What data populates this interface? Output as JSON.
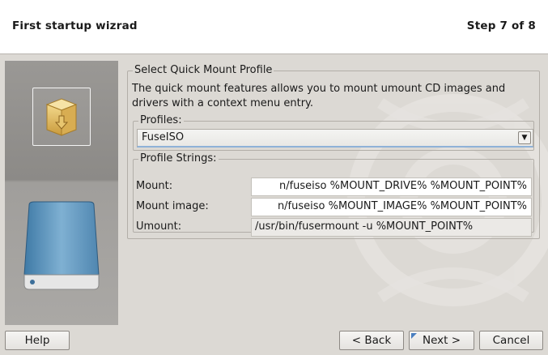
{
  "header": {
    "title": "First startup wizrad",
    "step": "Step 7 of 8"
  },
  "side": {
    "top_icon": "package-icon",
    "bottom_icon": "hard-drive-icon"
  },
  "main": {
    "group_title": "Select Quick Mount Profile",
    "description": "The quick mount features allows you to mount umount CD images and drivers with a context menu entry.",
    "profiles": {
      "title": "Profiles:",
      "selected": "FuseISO"
    },
    "strings": {
      "title": "Profile Strings:",
      "mount_label": "Mount:",
      "mount_value": "n/fuseiso %MOUNT_DRIVE% %MOUNT_POINT%",
      "mount_image_label": "Mount image:",
      "mount_image_value": "n/fuseiso %MOUNT_IMAGE% %MOUNT_POINT%",
      "umount_label": "Umount:",
      "umount_value": "/usr/bin/fusermount -u %MOUNT_POINT%"
    }
  },
  "buttons": {
    "help": "Help",
    "back": "< Back",
    "next": "Next >",
    "cancel": "Cancel"
  },
  "colors": {
    "header_bg": "#ffffff",
    "window_bg": "#dcd9d4",
    "side_panel": "#9a9895",
    "focus_accent": "#4a7fc0",
    "drive_blue": "#5f93b8"
  }
}
